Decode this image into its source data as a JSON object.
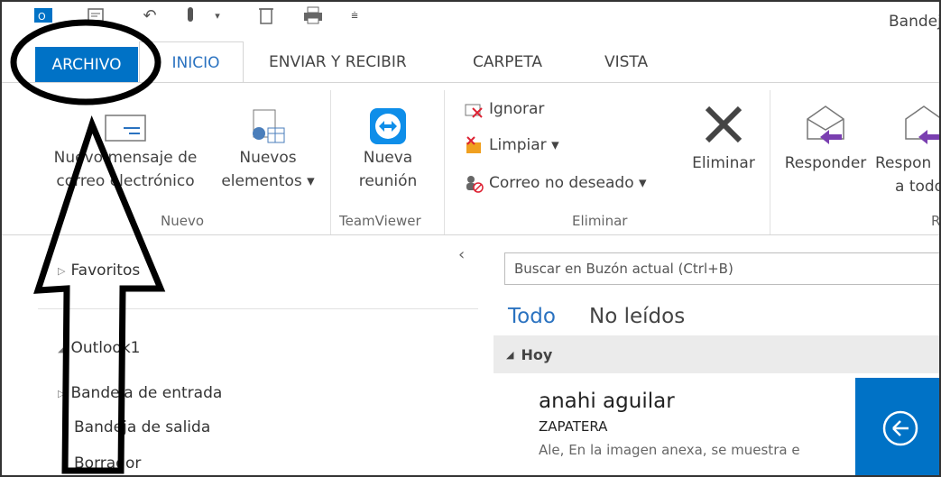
{
  "window": {
    "title": "Bandej"
  },
  "quick_access": {
    "icons": [
      "outlook-icon",
      "send-receive-icon",
      "undo-icon",
      "touch-mode-icon",
      "dropdown-icon",
      "trash-icon",
      "print-icon",
      "customize-icon"
    ]
  },
  "tabs": [
    {
      "label": "ARCHIVO"
    },
    {
      "label": "INICIO"
    },
    {
      "label": "ENVIAR Y RECIBIR"
    },
    {
      "label": "CARPETA"
    },
    {
      "label": "VISTA"
    }
  ],
  "ribbon": {
    "nuevo": {
      "group_label": "Nuevo",
      "new_mail_line1": "Nuevo mensaje de",
      "new_mail_line2": "correo electrónico",
      "new_items_line1": "Nuevos",
      "new_items_line2": "elementos ▾"
    },
    "teamviewer": {
      "group_label": "TeamViewer",
      "meeting_line1": "Nueva",
      "meeting_line2": "reunión"
    },
    "eliminar": {
      "group_label": "Eliminar",
      "ignorar": "Ignorar",
      "limpiar": "Limpiar ▾",
      "no_deseado": "Correo no deseado ▾",
      "eliminar": "Eliminar"
    },
    "responder": {
      "group_label": "R",
      "responder": "Responder",
      "responder_todos_line1": "Respon",
      "responder_todos_line2": "a todo"
    }
  },
  "nav": {
    "favoritos": "Favoritos",
    "account": "Outlook1",
    "inbox": "Bandeja de entrada",
    "outbox": "Bandeja de salida",
    "drafts": "Borrador"
  },
  "mail_list": {
    "search_placeholder": "Buscar en Buzón actual (Ctrl+B)",
    "filter_all": "Todo",
    "filter_unread": "No leídos",
    "group_today": "Hoy",
    "items": [
      {
        "sender": "anahi aguilar",
        "subject": "ZAPATERA",
        "preview": "Ale,  En la imagen anexa, se muestra e"
      }
    ]
  },
  "colors": {
    "accent": "#0072c6",
    "active_tab_text": "#2a72c0",
    "group_header_bg": "#ebebeb"
  }
}
